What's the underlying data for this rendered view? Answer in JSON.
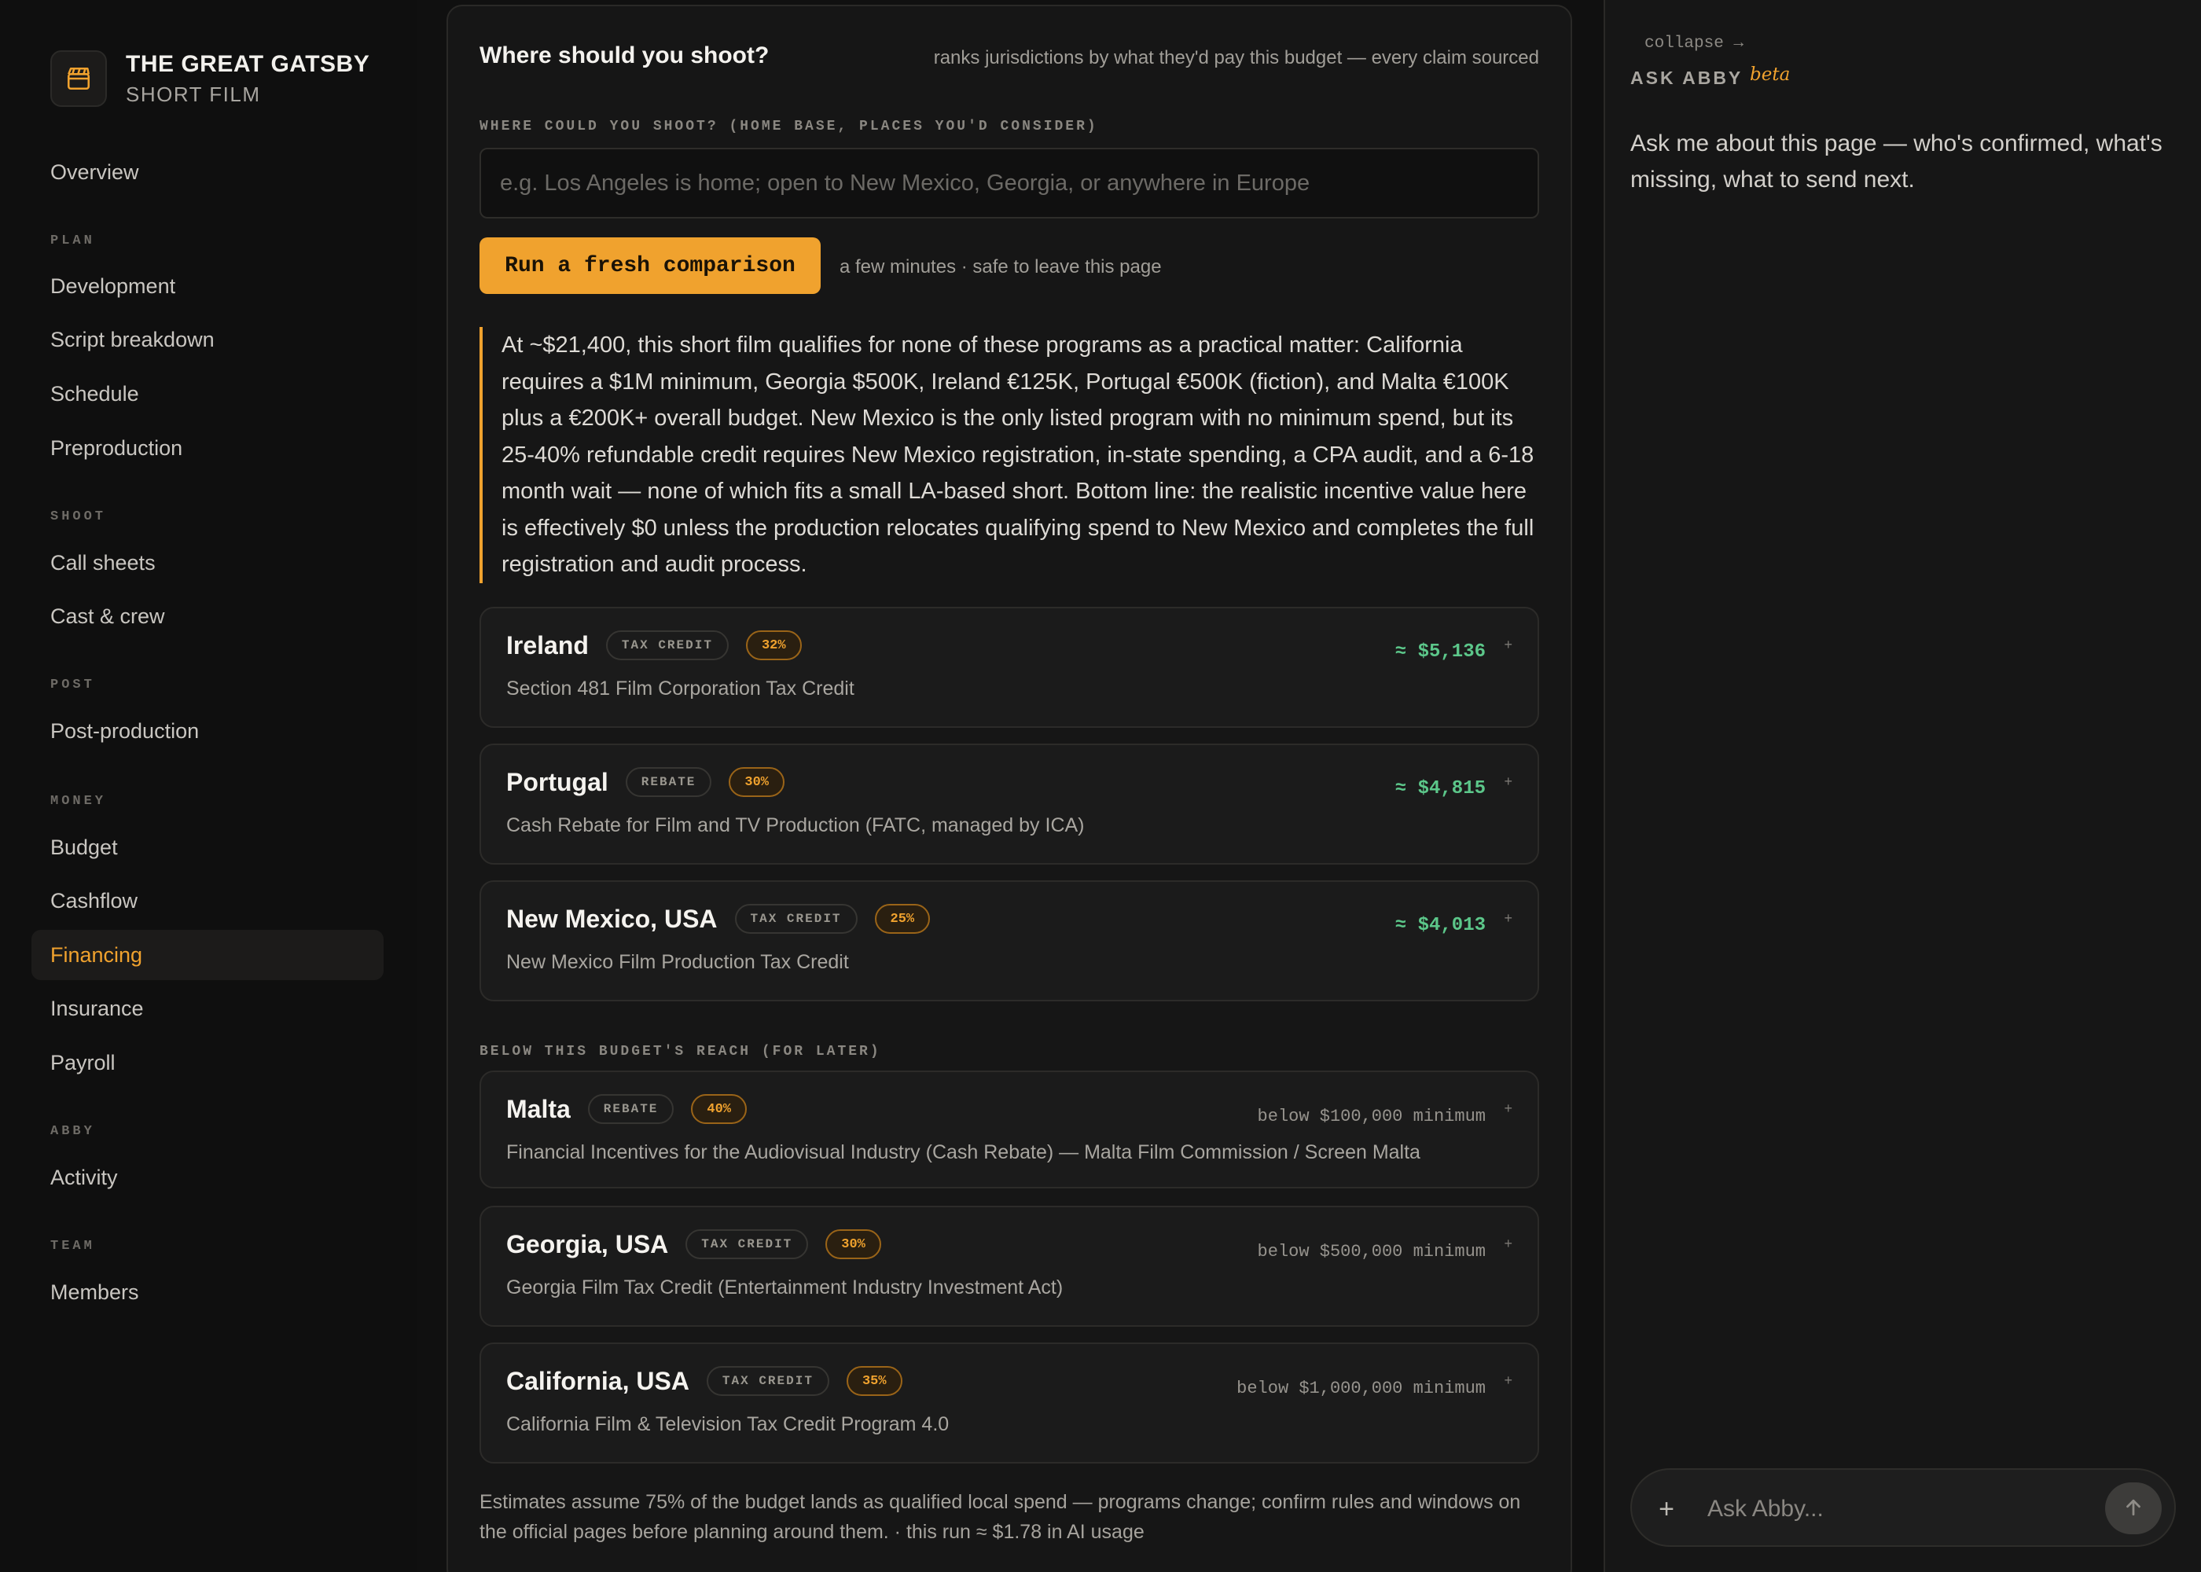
{
  "brand": {
    "title": "THE GREAT GATSBY",
    "subtitle": "SHORT FILM"
  },
  "nav": {
    "overview": "Overview",
    "sections": {
      "plan": "PLAN",
      "shoot": "SHOOT",
      "post": "POST",
      "money": "MONEY",
      "abby": "ABBY",
      "team": "TEAM"
    },
    "items": {
      "development": "Development",
      "script_breakdown": "Script breakdown",
      "schedule": "Schedule",
      "preproduction": "Preproduction",
      "call_sheets": "Call sheets",
      "cast_crew": "Cast & crew",
      "post_production": "Post-production",
      "budget": "Budget",
      "cashflow": "Cashflow",
      "financing": "Financing",
      "insurance": "Insurance",
      "payroll": "Payroll",
      "activity": "Activity",
      "members": "Members"
    },
    "active": "financing",
    "accent": "#f0a22e"
  },
  "main": {
    "title": "Where should you shoot?",
    "subtitle": "ranks jurisdictions by what they'd pay this budget — every claim sourced",
    "input_label": "WHERE COULD YOU SHOOT? (HOME BASE, PLACES YOU'D CONSIDER)",
    "input_placeholder": "e.g. Los Angeles is home; open to New Mexico, Georgia, or anywhere in Europe",
    "run_button": "Run a fresh comparison",
    "run_note": "a few minutes · safe to leave this page",
    "summary": "At ~$21,400, this short film qualifies for none of these programs as a practical matter: California requires a $1M minimum, Georgia $500K, Ireland €125K, Portugal €500K (fiction), and Malta €100K plus a €200K+ overall budget. New Mexico is the only listed program with no minimum spend, but its 25-40% refundable credit requires New Mexico registration, in-state spending, a CPA audit, and a 6-18 month wait — none of which fits a small LA-based short. Bottom line: the realistic incentive value here is effectively $0 unless the production relocates qualifying spend to New Mexico and completes the full registration and audit process.",
    "programs": [
      {
        "name": "Ireland",
        "type": "TAX CREDIT",
        "rate": "32%",
        "description": "Section 481 Film Corporation Tax Credit",
        "value": "≈ $5,136",
        "more": "+"
      },
      {
        "name": "Portugal",
        "type": "REBATE",
        "rate": "30%",
        "description": "Cash Rebate for Film and TV Production (FATC, managed by ICA)",
        "value": "≈ $4,815",
        "more": "+"
      },
      {
        "name": "New Mexico, USA",
        "type": "TAX CREDIT",
        "rate": "25%",
        "description": "New Mexico Film Production Tax Credit",
        "value": "≈ $4,013",
        "more": "+"
      }
    ],
    "below_label": "BELOW THIS BUDGET'S REACH (FOR LATER)",
    "below_programs": [
      {
        "name": "Malta",
        "type": "REBATE",
        "rate": "40%",
        "description": "Financial Incentives for the Audiovisual Industry (Cash Rebate) — Malta Film Commission / Screen Malta",
        "value": "below $100,000 minimum",
        "more": "+"
      },
      {
        "name": "Georgia, USA",
        "type": "TAX CREDIT",
        "rate": "30%",
        "description": "Georgia Film Tax Credit (Entertainment Industry Investment Act)",
        "value": "below $500,000 minimum",
        "more": "+"
      },
      {
        "name": "California, USA",
        "type": "TAX CREDIT",
        "rate": "35%",
        "description": "California Film & Television Tax Credit Program 4.0",
        "value": "below $1,000,000 minimum",
        "more": "+"
      }
    ],
    "footnote": "Estimates assume 75% of the budget lands as qualified local spend — programs change; confirm rules and windows on the official pages before planning around them. · this run ≈ $1.78 in AI usage",
    "value_color": "#5cc78a"
  },
  "assistant": {
    "collapse": "collapse →",
    "title": "ASK ABBY",
    "badge": "beta",
    "intro": "Ask me about this page — who's confirmed, what's missing, what to send next.",
    "input_placeholder": "Ask Abby...",
    "plus": "+",
    "icons": {
      "attach": "plus-icon",
      "send": "arrow-up-icon"
    }
  }
}
